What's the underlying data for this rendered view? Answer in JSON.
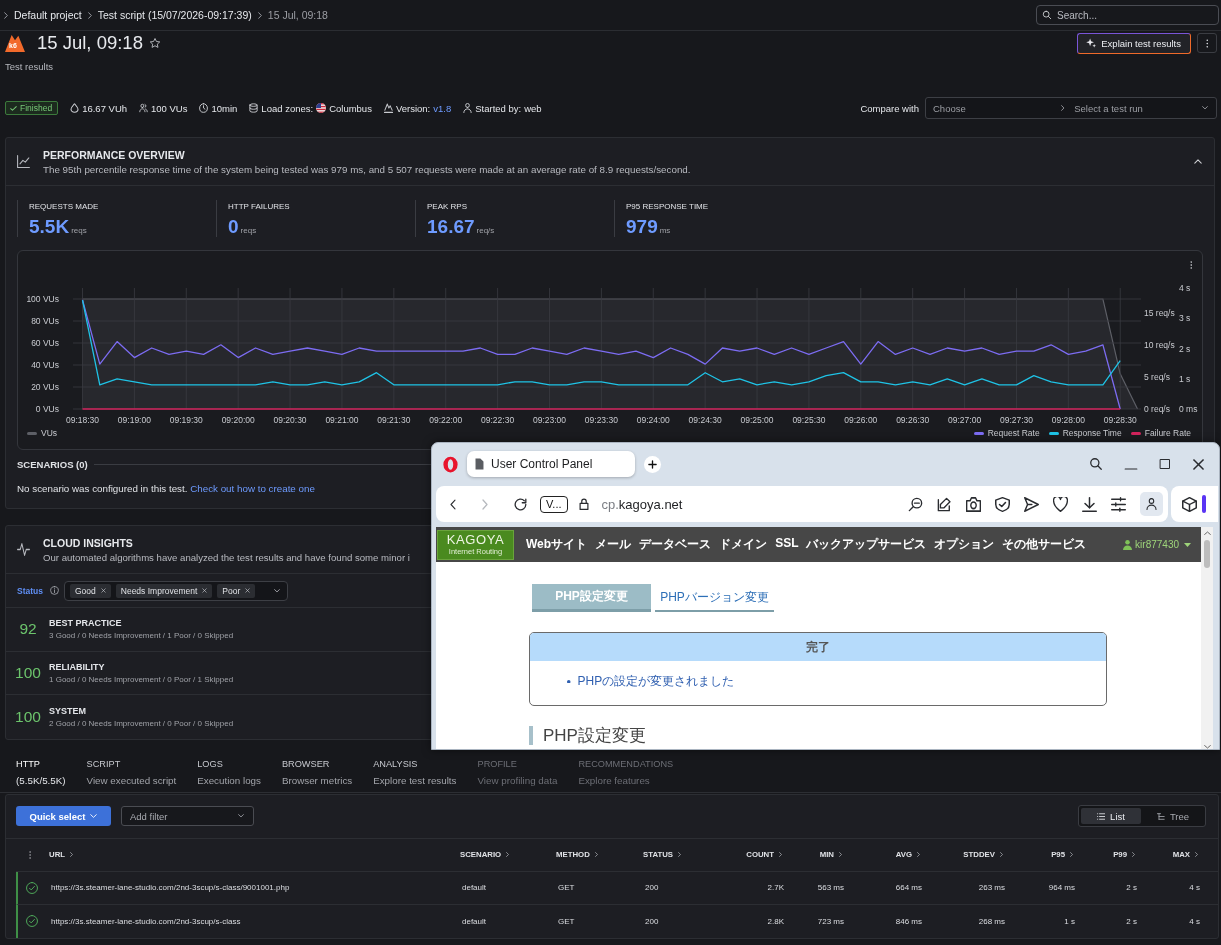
{
  "breadcrumb": {
    "items": [
      {
        "label": "Default project",
        "current": false
      },
      {
        "label": "Test script (15/07/2026-09:17:39)",
        "current": false
      },
      {
        "label": "15 Jul, 09:18",
        "current": true
      }
    ]
  },
  "search": {
    "placeholder": "Search..."
  },
  "header": {
    "logo_text": "k6",
    "title": "15 Jul, 09:18",
    "starred": false,
    "subtitle": "Test results",
    "explain_button": "Explain test results"
  },
  "summary": {
    "status": {
      "label": "Finished",
      "kind": "success"
    },
    "items": [
      {
        "kind": "vuh",
        "value": "16.67 VUh"
      },
      {
        "kind": "vus",
        "value": "100 VUs"
      },
      {
        "kind": "duration",
        "value": "10min"
      },
      {
        "kind": "zones",
        "label": "Load zones:",
        "value": "Columbus"
      },
      {
        "kind": "version",
        "label": "Version:",
        "value": "v1.8"
      },
      {
        "kind": "user",
        "label": "Started by:",
        "value": "web"
      }
    ]
  },
  "compare": {
    "label": "Compare with",
    "test_placeholder": "Choose",
    "run_placeholder": "Select a test run"
  },
  "performance": {
    "title": "PERFORMANCE OVERVIEW",
    "description": "The 95th percentile response time of the system being tested was 979 ms, and 5 507 requests were made at an average rate of 8.9 requests/second.",
    "expanded": true,
    "stats": [
      {
        "label": "REQUESTS MADE",
        "value": "5.5K",
        "unit": "reqs"
      },
      {
        "label": "HTTP FAILURES",
        "value": "0",
        "unit": "reqs"
      },
      {
        "label": "PEAK RPS",
        "value": "16.67",
        "unit": "req/s"
      },
      {
        "label": "P95 RESPONSE TIME",
        "value": "979",
        "unit": "ms"
      }
    ],
    "chart_data": {
      "type": "line",
      "grid": true,
      "categories": [
        "09:18:30",
        null,
        null,
        "09:19:00",
        null,
        null,
        "09:19:30",
        null,
        null,
        "09:20:00",
        null,
        null,
        "09:20:30",
        null,
        null,
        "09:21:00",
        null,
        null,
        "09:21:30",
        null,
        null,
        "09:22:00",
        null,
        null,
        "09:22:30",
        null,
        null,
        "09:23:00",
        null,
        null,
        "09:23:30",
        null,
        null,
        "09:24:00",
        null,
        null,
        "09:24:30",
        null,
        null,
        "09:25:00",
        null,
        null,
        "09:25:30",
        null,
        null,
        "09:26:00",
        null,
        null,
        "09:26:30",
        null,
        null,
        "09:27:00",
        null,
        null,
        "09:27:30",
        null,
        null,
        "09:28:00",
        null,
        null,
        "09:28:30",
        null
      ],
      "ylim": [
        0,
        110
      ],
      "yticks": [
        {
          "value": 0,
          "label": "0 VUs"
        },
        {
          "value": 20,
          "label": "20 VUs"
        },
        {
          "value": 40,
          "label": "40 VUs"
        },
        {
          "value": 60,
          "label": "60 VUs"
        },
        {
          "value": 80,
          "label": "80 VUs"
        },
        {
          "value": 100,
          "label": "100 VUs"
        }
      ],
      "y2lim": [
        0,
        18.85
      ],
      "y2ticks": [
        {
          "value": 0,
          "label": "0 req/s"
        },
        {
          "value": 5,
          "label": "5 req/s"
        },
        {
          "value": 10,
          "label": "10 req/s"
        },
        {
          "value": 15,
          "label": "15 req/s"
        }
      ],
      "y3lim": [
        0,
        4
      ],
      "y3ticks": [
        {
          "value": 0,
          "label": "0 ms"
        },
        {
          "value": 1,
          "label": "1 s"
        },
        {
          "value": 2,
          "label": "2 s"
        },
        {
          "value": 3,
          "label": "3 s"
        },
        {
          "value": 4,
          "label": "4 s"
        }
      ],
      "series": [
        {
          "name": "VUs",
          "color": "#5d5f66",
          "values": [
            100,
            100,
            100,
            100,
            100,
            100,
            100,
            100,
            100,
            100,
            100,
            100,
            100,
            100,
            100,
            100,
            100,
            100,
            100,
            100,
            100,
            100,
            100,
            100,
            100,
            100,
            100,
            100,
            100,
            100,
            100,
            100,
            100,
            100,
            100,
            100,
            100,
            100,
            100,
            100,
            100,
            100,
            100,
            100,
            100,
            100,
            100,
            100,
            100,
            100,
            100,
            100,
            100,
            100,
            100,
            100,
            100,
            100,
            100,
            100,
            32,
            0
          ]
        },
        {
          "name": "Request Rate",
          "color": "#7c6cf2",
          "axis": "y2",
          "values": [
            17,
            7,
            10.5,
            8,
            9.5,
            8.5,
            9,
            8.5,
            10,
            8,
            9.5,
            8.5,
            9,
            9.5,
            9,
            8.5,
            9.5,
            9,
            9,
            9,
            9,
            9,
            9,
            9.5,
            8.5,
            8.5,
            9.5,
            9,
            8.5,
            9.5,
            9,
            8.5,
            9,
            8,
            9.5,
            8.5,
            7,
            9.5,
            9,
            9.5,
            8.5,
            9.5,
            8.5,
            9.5,
            10.5,
            7,
            10.5,
            8.5,
            9.5,
            8.5,
            9.5,
            9,
            9.5,
            8.5,
            9,
            9,
            10,
            8.5,
            9,
            10,
            0,
            null
          ]
        },
        {
          "name": "Response Time",
          "color": "#1fc3e6",
          "axis": "y3",
          "values": [
            3.6,
            0.8,
            1,
            0.9,
            0.8,
            0.8,
            0.8,
            0.8,
            0.8,
            0.8,
            0.8,
            0.9,
            0.8,
            0.8,
            0.9,
            0.8,
            0.9,
            1.2,
            0.8,
            0.8,
            0.8,
            0.8,
            0.8,
            0.8,
            0.8,
            0.9,
            0.9,
            0.8,
            0.8,
            0.9,
            0.9,
            0.8,
            0.8,
            0.8,
            0.8,
            0.8,
            1.2,
            0.9,
            1,
            0.8,
            0.9,
            0.8,
            0.9,
            1.1,
            1.2,
            0.9,
            0.9,
            0.8,
            0.9,
            0.8,
            1,
            0.8,
            1,
            0.8,
            0.8,
            1.1,
            0.9,
            0.8,
            0.8,
            0.8,
            1.6,
            null
          ]
        },
        {
          "name": "Failure Rate",
          "color": "#d2245c",
          "axis": "y2",
          "values": [
            0,
            0,
            0,
            0,
            0,
            0,
            0,
            0,
            0,
            0,
            0,
            0,
            0,
            0,
            0,
            0,
            0,
            0,
            0,
            0,
            0,
            0,
            0,
            0,
            0,
            0,
            0,
            0,
            0,
            0,
            0,
            0,
            0,
            0,
            0,
            0,
            0,
            0,
            0,
            0,
            0,
            0,
            0,
            0,
            0,
            0,
            0,
            0,
            0,
            0,
            0,
            0,
            0,
            0,
            0,
            0,
            0,
            0,
            0,
            0,
            0,
            null
          ]
        }
      ]
    },
    "scenarios": {
      "title": "SCENARIOS (0)",
      "message": "No scenario was configured in this test.",
      "link": "Check out how to create one"
    }
  },
  "insights": {
    "title": "CLOUD INSIGHTS",
    "description": "Our automated algorithms have analyzed the test results and have found some minor i",
    "filter": {
      "label": "Status",
      "chips": [
        "Good",
        "Needs Improvement",
        "Poor"
      ]
    },
    "categories": [
      {
        "score": "92",
        "name": "BEST PRACTICE",
        "summary": "3 Good / 0 Needs Improvement / 1 Poor / 0 Skipped"
      },
      {
        "score": "100",
        "name": "RELIABILITY",
        "summary": "1 Good / 0 Needs Improvement / 0 Poor / 1 Skipped"
      },
      {
        "score": "100",
        "name": "SYSTEM",
        "summary": "2 Good / 0 Needs Improvement / 0 Poor / 0 Skipped"
      }
    ]
  },
  "tabs": [
    {
      "label": "HTTP",
      "sub": "(5.5K/5.5K)",
      "selected": true,
      "disabled": false
    },
    {
      "label": "SCRIPT",
      "sub": "View executed script",
      "selected": false,
      "disabled": false
    },
    {
      "label": "LOGS",
      "sub": "Execution logs",
      "selected": false,
      "disabled": false
    },
    {
      "label": "BROWSER",
      "sub": "Browser metrics",
      "selected": false,
      "disabled": false
    },
    {
      "label": "ANALYSIS",
      "sub": "Explore test results",
      "selected": false,
      "disabled": false
    },
    {
      "label": "PROFILE",
      "sub": "View profiling data",
      "selected": false,
      "disabled": true
    },
    {
      "label": "RECOMMENDATIONS",
      "sub": "Explore features",
      "selected": false,
      "disabled": true
    }
  ],
  "http": {
    "quick_select": "Quick select",
    "filter_placeholder": "Add filter",
    "views": [
      {
        "label": "List",
        "kind": "list",
        "selected": true
      },
      {
        "label": "Tree",
        "kind": "tree",
        "selected": false
      }
    ],
    "columns": [
      "URL",
      "SCENARIO",
      "METHOD",
      "STATUS",
      "COUNT",
      "MIN",
      "AVG",
      "STDDEV",
      "P95",
      "P99",
      "MAX"
    ],
    "rows": [
      {
        "passed": true,
        "cells": [
          "https://3s.steamer-lane-studio.com/2nd-3scup/s-class/9001001.php",
          "default",
          "GET",
          "200",
          "2.7K",
          "563 ms",
          "664 ms",
          "263 ms",
          "964 ms",
          "2 s",
          "4 s"
        ]
      },
      {
        "passed": true,
        "cells": [
          "https://3s.steamer-lane-studio.com/2nd-3scup/s-class",
          "default",
          "GET",
          "200",
          "2.8K",
          "723 ms",
          "846 ms",
          "268 ms",
          "1 s",
          "2 s",
          "4 s"
        ]
      }
    ]
  },
  "browser": {
    "tab_title": "User Control Panel",
    "site_badge": "V...",
    "url_prefix": "cp.",
    "url_domain": "kagoya.net",
    "can_go_forward": false,
    "site": {
      "logo": "KAGOYA",
      "logo_tagline": "Internet Routing",
      "nav": [
        "Webサイト",
        "メール",
        "データベース",
        "ドメイン",
        "SSL",
        "バックアップサービス",
        "オプション",
        "その他サービス"
      ],
      "user": "kir877430",
      "tabs": [
        {
          "label": "PHP設定変更",
          "selected": true
        },
        {
          "label": "PHPバージョン変更",
          "selected": false
        }
      ],
      "notice": {
        "title": "完了",
        "items": [
          "PHPの設定が変更されました"
        ]
      },
      "heading": "PHP設定変更"
    }
  }
}
